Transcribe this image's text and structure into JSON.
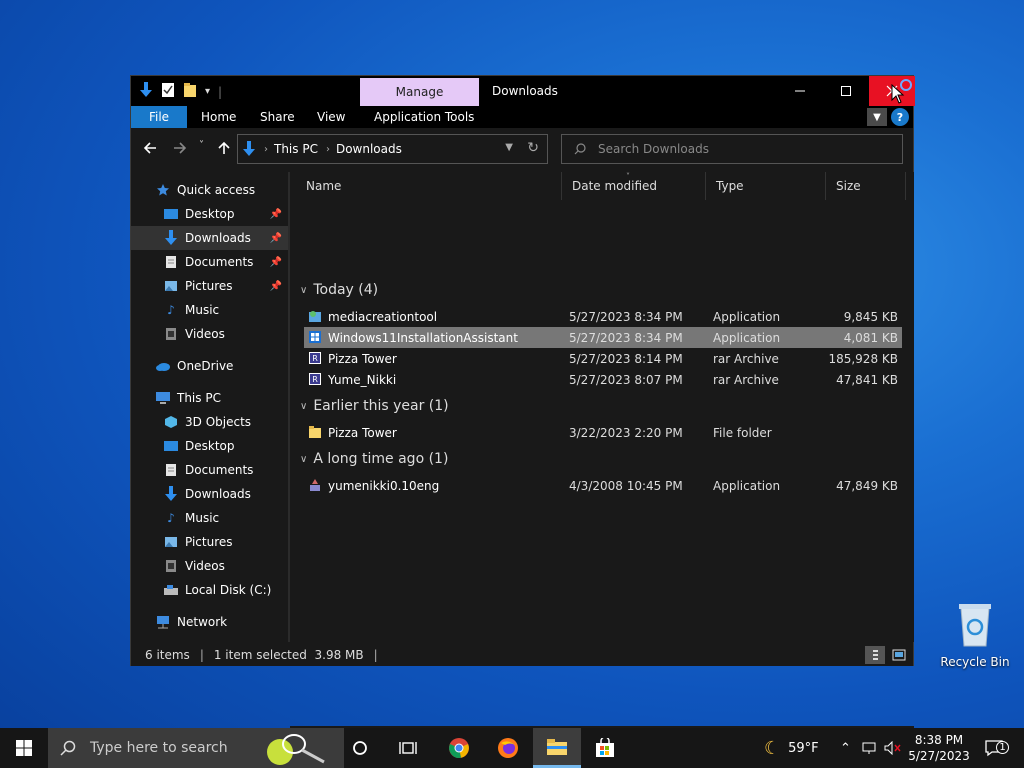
{
  "desktop": {
    "recycle_bin_label": "Recycle Bin"
  },
  "window": {
    "title": "Downloads",
    "contextual_tab": "Manage",
    "ribbon_tabs": [
      "File",
      "Home",
      "Share",
      "View",
      "Application Tools"
    ]
  },
  "address": {
    "crumbs": [
      "This PC",
      "Downloads"
    ],
    "search_placeholder": "Search Downloads"
  },
  "nav": {
    "quick_access": "Quick access",
    "qa_items": [
      "Desktop",
      "Downloads",
      "Documents",
      "Pictures",
      "Music",
      "Videos"
    ],
    "onedrive": "OneDrive",
    "this_pc": "This PC",
    "pc_items": [
      "3D Objects",
      "Desktop",
      "Documents",
      "Downloads",
      "Music",
      "Pictures",
      "Videos",
      "Local Disk (C:)"
    ],
    "network": "Network"
  },
  "columns": [
    "Name",
    "Date modified",
    "Type",
    "Size"
  ],
  "groups": [
    {
      "label": "Today (4)",
      "files": [
        {
          "name": "mediacreationtool",
          "date": "5/27/2023 8:34 PM",
          "type": "Application",
          "size": "9,845 KB",
          "icon": "installer-icon"
        },
        {
          "name": "Windows11InstallationAssistant",
          "date": "5/27/2023 8:34 PM",
          "type": "Application",
          "size": "4,081 KB",
          "icon": "windows-app-icon",
          "selected": true
        },
        {
          "name": "Pizza Tower",
          "date": "5/27/2023 8:14 PM",
          "type": "rar Archive",
          "size": "185,928 KB",
          "icon": "rar-icon"
        },
        {
          "name": "Yume_Nikki",
          "date": "5/27/2023 8:07 PM",
          "type": "rar Archive",
          "size": "47,841 KB",
          "icon": "rar-icon"
        }
      ]
    },
    {
      "label": "Earlier this year (1)",
      "files": [
        {
          "name": "Pizza Tower",
          "date": "3/22/2023 2:20 PM",
          "type": "File folder",
          "size": "",
          "icon": "folder-icon"
        }
      ]
    },
    {
      "label": "A long time ago (1)",
      "files": [
        {
          "name": "yumenikki0.10eng",
          "date": "4/3/2008 10:45 PM",
          "type": "Application",
          "size": "47,849 KB",
          "icon": "setup-icon"
        }
      ]
    }
  ],
  "status": {
    "items": "6 items",
    "selected": "1 item selected  3.98 MB"
  },
  "taskbar": {
    "search_placeholder": "Type here to search",
    "weather": "59°F",
    "time": "8:38 PM",
    "date": "5/27/2023",
    "notification_count": "1"
  },
  "colors": {
    "accent": "#1979ca",
    "manage": "#e5c9f7",
    "close": "#e81123"
  }
}
